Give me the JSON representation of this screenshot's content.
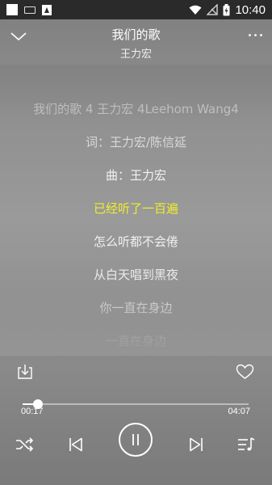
{
  "status_bar": {
    "time": "10:40"
  },
  "song": {
    "title": "我们的歌",
    "artist": "王力宏"
  },
  "lyrics": [
    {
      "text": "我们的歌 4 王力宏 4Leehom Wang4",
      "state": "past"
    },
    {
      "text": "词：王力宏/陈信延",
      "state": "past"
    },
    {
      "text": "曲：王力宏",
      "state": "past"
    },
    {
      "text": "已经听了一百遍",
      "state": "current"
    },
    {
      "text": "怎么听都不会倦",
      "state": "upcoming"
    },
    {
      "text": "从白天唱到黑夜",
      "state": "upcoming"
    },
    {
      "text": "你一直在身边",
      "state": "upcoming"
    },
    {
      "text": "一直在身边",
      "state": "upcoming"
    }
  ],
  "player": {
    "elapsed": "00:17",
    "total": "04:07",
    "progress_fraction": 0.069,
    "is_playing": true
  },
  "colors": {
    "active_lyric": "#f0ee2a",
    "text": "#ffffff"
  },
  "icons": {
    "download": "download-icon",
    "favorite": "heart-icon",
    "shuffle": "shuffle-icon",
    "previous": "previous-icon",
    "pause": "pause-icon",
    "next": "next-icon",
    "playlist": "playlist-icon"
  }
}
